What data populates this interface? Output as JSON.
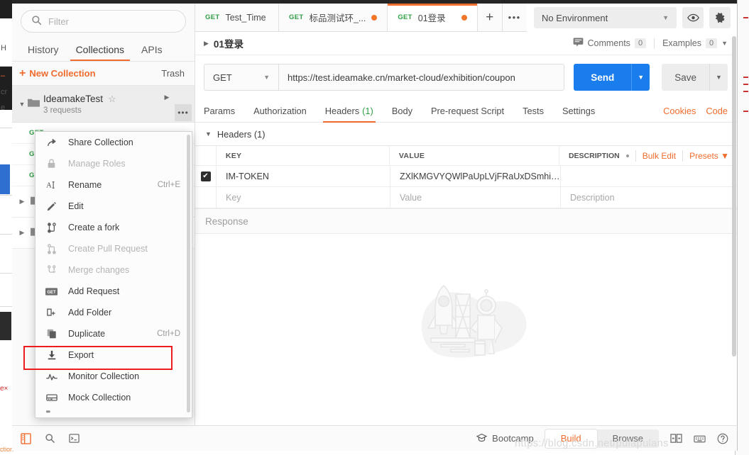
{
  "sidebar": {
    "filter_placeholder": "Filter",
    "tabs": [
      {
        "label": "History",
        "active": false
      },
      {
        "label": "Collections",
        "active": true
      },
      {
        "label": "APIs",
        "active": false
      }
    ],
    "new_collection_label": "New Collection",
    "trash_label": "Trash",
    "collection": {
      "name": "IdeamakeTest",
      "subtitle": "3 requests",
      "star_icon": "star-outline-icon",
      "folder_icon": "folder-icon",
      "run_icon": "play-triangle-icon",
      "more_icon": "ellipsis-icon"
    },
    "requests": [
      {
        "method": "GET",
        "name": ""
      },
      {
        "method": "GET",
        "name": ""
      },
      {
        "method": "GET",
        "name": ""
      }
    ],
    "folders": [
      {
        "icon": "folder-icon"
      },
      {
        "icon": "folder-icon"
      }
    ]
  },
  "context_menu": {
    "highlighted_item": "Export",
    "highlight_color": "#ee1c1c",
    "items": [
      {
        "label": "Share Collection",
        "icon": "share-arrow-icon",
        "shortcut": "",
        "disabled": false
      },
      {
        "label": "Manage Roles",
        "icon": "lock-icon",
        "shortcut": "",
        "disabled": true
      },
      {
        "label": "Rename",
        "icon": "text-cursor-icon",
        "shortcut": "Ctrl+E",
        "disabled": false
      },
      {
        "label": "Edit",
        "icon": "pencil-icon",
        "shortcut": "",
        "disabled": false
      },
      {
        "label": "Create a fork",
        "icon": "fork-icon",
        "shortcut": "",
        "disabled": false
      },
      {
        "label": "Create Pull Request",
        "icon": "pull-request-icon",
        "shortcut": "",
        "disabled": true
      },
      {
        "label": "Merge changes",
        "icon": "merge-icon",
        "shortcut": "",
        "disabled": true
      },
      {
        "label": "Add Request",
        "icon": "get-badge-icon",
        "shortcut": "",
        "disabled": false
      },
      {
        "label": "Add Folder",
        "icon": "folder-plus-icon",
        "shortcut": "",
        "disabled": false
      },
      {
        "label": "Duplicate",
        "icon": "copy-icon",
        "shortcut": "Ctrl+D",
        "disabled": false
      },
      {
        "label": "Export",
        "icon": "download-icon",
        "shortcut": "",
        "disabled": false
      },
      {
        "label": "Monitor Collection",
        "icon": "pulse-icon",
        "shortcut": "",
        "disabled": false
      },
      {
        "label": "Mock Collection",
        "icon": "server-icon",
        "shortcut": "",
        "disabled": false
      }
    ]
  },
  "tabs": {
    "items": [
      {
        "method": "GET",
        "title": "Test_Time",
        "dirty": false,
        "active": false
      },
      {
        "method": "GET",
        "title": "标品测试环_...",
        "dirty": true,
        "active": false
      },
      {
        "method": "GET",
        "title": "01登录",
        "dirty": true,
        "active": true
      }
    ],
    "new_tab_icon": "plus-icon",
    "more_tabs_icon": "ellipsis-icon"
  },
  "environment": {
    "selected": "No Environment",
    "eye_icon": "eye-icon",
    "gear_icon": "gear-icon"
  },
  "breadcrumb": {
    "title": "01登录",
    "comments_label": "Comments",
    "comments_count": "0",
    "examples_label": "Examples",
    "examples_count": "0",
    "comment_icon": "comment-icon"
  },
  "request": {
    "method": "GET",
    "url": "https://test.ideamake.cn/market-cloud/exhibition/coupon",
    "send_label": "Send",
    "save_label": "Save"
  },
  "request_tabs": {
    "items": [
      {
        "label": "Params",
        "count": "",
        "active": false
      },
      {
        "label": "Authorization",
        "count": "",
        "active": false
      },
      {
        "label": "Headers",
        "count": "(1)",
        "active": true
      },
      {
        "label": "Body",
        "count": "",
        "active": false
      },
      {
        "label": "Pre-request Script",
        "count": "",
        "active": false
      },
      {
        "label": "Tests",
        "count": "",
        "active": false
      },
      {
        "label": "Settings",
        "count": "",
        "active": false
      }
    ],
    "right_links": [
      "Cookies",
      "Code"
    ]
  },
  "headers_panel": {
    "section_title": "Headers (1)",
    "columns": [
      "KEY",
      "VALUE",
      "DESCRIPTION"
    ],
    "bulk_edit_label": "Bulk Edit",
    "presets_label": "Presets",
    "rows": [
      {
        "checked": true,
        "key": "IM-TOKEN",
        "value": "ZXlKMGVYQWlPaUpLVjFRaUxDSmhiR2...",
        "description": ""
      }
    ],
    "placeholder_row": {
      "key": "Key",
      "value": "Value",
      "description": "Description"
    }
  },
  "response": {
    "title": "Response",
    "illustration": "rocket-astronaut-illustration"
  },
  "statusbar": {
    "left_icons": [
      "sidebar-toggle-icon",
      "search-icon",
      "console-icon"
    ],
    "bootcamp_label": "Bootcamp",
    "bootcamp_icon": "graduation-cap-icon",
    "build_label": "Build",
    "browse_label": "Browse",
    "right_icons": [
      "two-pane-icon",
      "keyboard-icon",
      "help-icon"
    ]
  },
  "watermark": "https://blog.csdn.net/pulapulans"
}
